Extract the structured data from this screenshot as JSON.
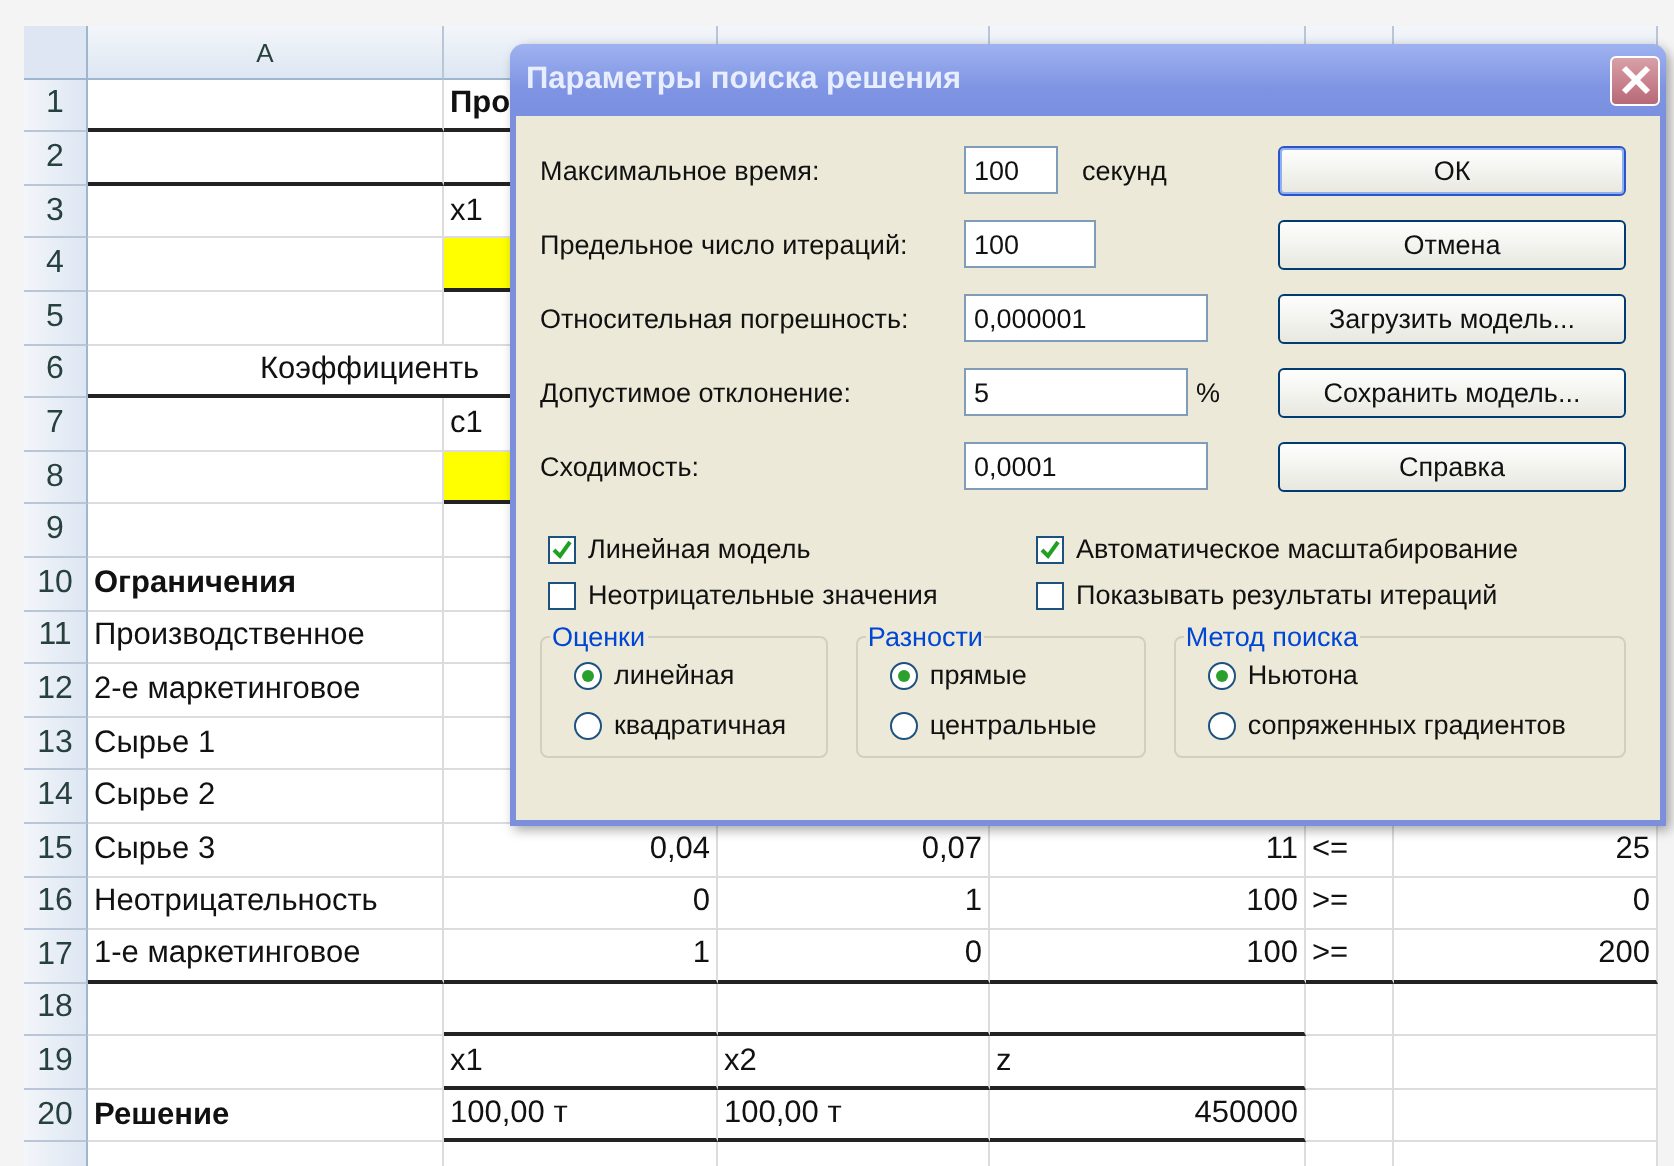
{
  "sheet": {
    "column_header": "A",
    "rows": [
      {
        "number": "1",
        "bold": true,
        "b": "Про"
      },
      {
        "number": "2"
      },
      {
        "number": "3",
        "b": "x1"
      },
      {
        "number": "4",
        "b_highlighted": true
      },
      {
        "number": "5"
      },
      {
        "number": "6",
        "a": "Коэффициенть"
      },
      {
        "number": "7",
        "b": "c1"
      },
      {
        "number": "8",
        "b_highlighted": true
      },
      {
        "number": "9"
      },
      {
        "number": "10",
        "bold": true,
        "a": "Ограничения"
      },
      {
        "number": "11",
        "a": "Производственное"
      },
      {
        "number": "12",
        "a": "2-е маркетинговое"
      },
      {
        "number": "13",
        "a": "Сырье 1"
      },
      {
        "number": "14",
        "a": "Сырье 2"
      },
      {
        "number": "15",
        "a": "Сырье 3",
        "b": "0,04",
        "c": "0,07",
        "d": "11",
        "e": "<=",
        "f": "25"
      },
      {
        "number": "16",
        "a": "Неотрицательность",
        "b": "0",
        "c": "1",
        "d": "100",
        "e": ">=",
        "f": "0"
      },
      {
        "number": "17",
        "a": "1-е маркетинговое",
        "b": "1",
        "c": "0",
        "d": "100",
        "e": ">=",
        "f": "200"
      },
      {
        "number": "18"
      },
      {
        "number": "19",
        "b": "x1",
        "c": "x2",
        "d": "z"
      },
      {
        "number": "20",
        "bold": true,
        "a": "Решение",
        "b": "100,00 т",
        "c": "100,00 т",
        "d": "450000"
      }
    ]
  },
  "dialog": {
    "title": "Параметры поиска решения",
    "fields": [
      {
        "label": "Максимальное время:",
        "value": "100",
        "unit": "секунд"
      },
      {
        "label": "Предельное число итераций:",
        "value": "100"
      },
      {
        "label": "Относительная погрешность:",
        "value": "0,000001"
      },
      {
        "label": "Допустимое отклонение:",
        "value": "5",
        "unit": "%"
      },
      {
        "label": "Сходимость:",
        "value": "0,0001"
      }
    ],
    "buttons": [
      {
        "label": "ОК",
        "default": true
      },
      {
        "label": "Отмена",
        "default": false
      },
      {
        "label": "Загрузить модель...",
        "default": false
      },
      {
        "label": "Сохранить модель...",
        "default": false
      },
      {
        "label": "Справка",
        "default": false
      }
    ],
    "checkboxes": [
      {
        "label": "Линейная модель",
        "checked": true
      },
      {
        "label": "Автоматическое масштабирование",
        "checked": true
      },
      {
        "label": "Неотрицательные значения",
        "checked": false
      },
      {
        "label": "Показывать результаты итераций",
        "checked": false
      }
    ],
    "groups": [
      {
        "title": "Оценки",
        "options": [
          {
            "label": "линейная",
            "selected": true
          },
          {
            "label": "квадратичная",
            "selected": false
          }
        ]
      },
      {
        "title": "Разности",
        "options": [
          {
            "label": "прямые",
            "selected": true
          },
          {
            "label": "центральные",
            "selected": false
          }
        ]
      },
      {
        "title": "Метод поиска",
        "options": [
          {
            "label": "Ньютона",
            "selected": true
          },
          {
            "label": "сопряженных градиентов",
            "selected": false
          }
        ]
      }
    ]
  }
}
